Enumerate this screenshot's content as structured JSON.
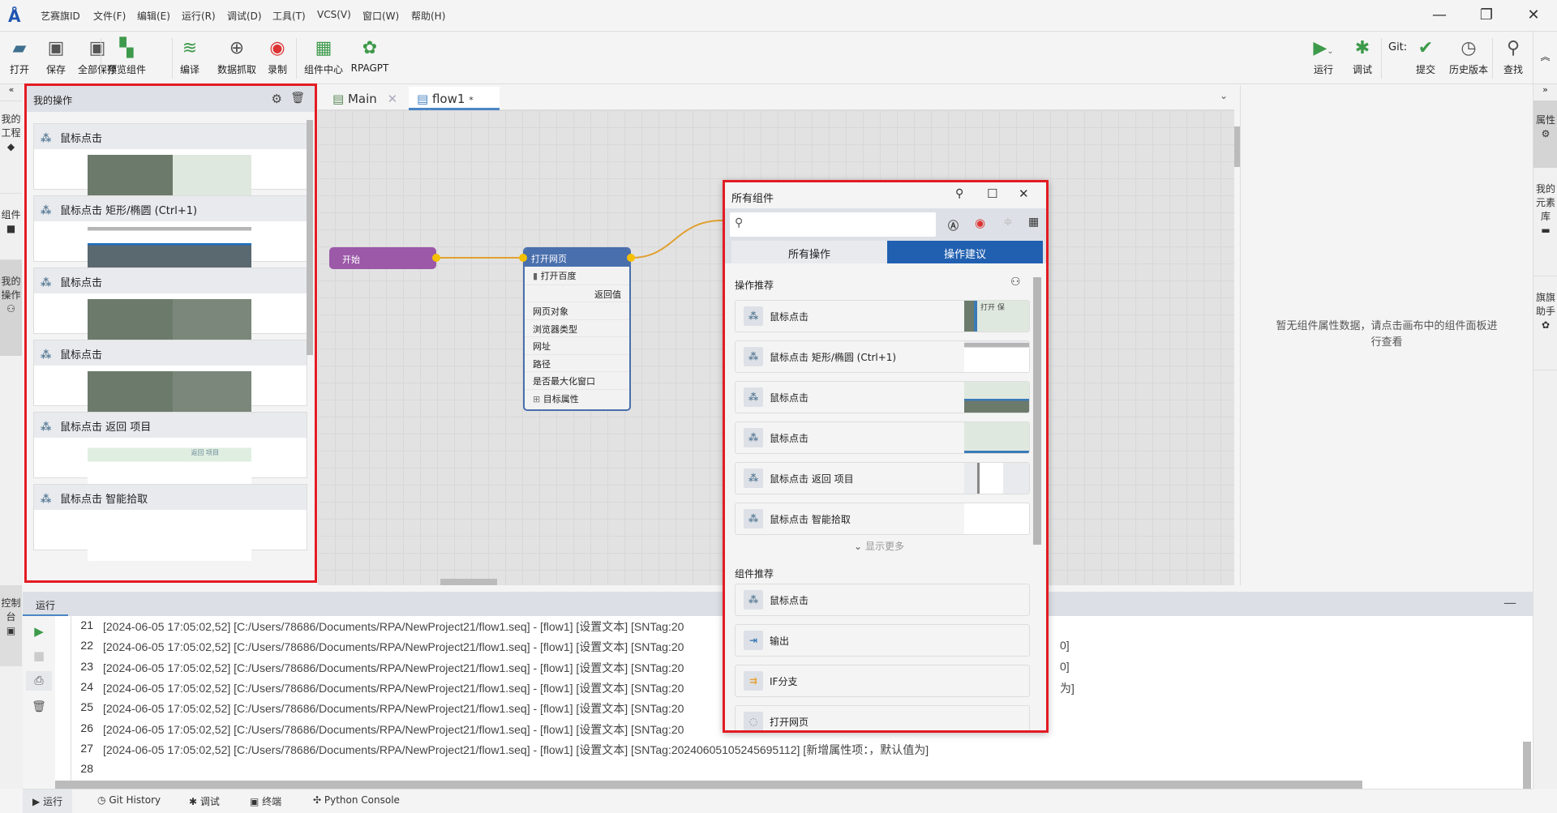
{
  "app": {
    "title": "艺赛旗ID",
    "menu": [
      "文件(F)",
      "编辑(E)",
      "运行(R)",
      "调试(D)",
      "工具(T)",
      "VCS(V)",
      "窗口(W)",
      "帮助(H)"
    ]
  },
  "toolbar": {
    "left": [
      {
        "label": "打开",
        "icon": "folder-open-icon"
      },
      {
        "label": "保存",
        "icon": "save-icon"
      },
      {
        "label": "全部保存",
        "icon": "save-all-icon"
      },
      {
        "label": "预览组件",
        "icon": "preview-components-icon"
      },
      {
        "label": "编译",
        "icon": "compile-icon"
      },
      {
        "label": "数据抓取",
        "icon": "data-scrape-icon"
      },
      {
        "label": "录制",
        "icon": "record-icon"
      },
      {
        "label": "组件中心",
        "icon": "component-center-icon"
      },
      {
        "label": "RPAGPT",
        "icon": "rpagpt-icon"
      }
    ],
    "right": {
      "run": "运行",
      "debug": "调试",
      "git_label": "Git:",
      "commit": "提交",
      "history": "历史版本",
      "search": "查找"
    }
  },
  "left_sidebar": {
    "tabs": [
      "我的工程",
      "组件",
      "我的操作"
    ],
    "console": "控制台"
  },
  "my_operations": {
    "title": "我的操作",
    "items": [
      "鼠标点击",
      "鼠标点击 矩形/椭圆 (Ctrl+1)",
      "鼠标点击",
      "鼠标点击",
      "鼠标点击 返回 项目",
      "鼠标点击 智能拾取"
    ],
    "thumb_text": "返回 项目"
  },
  "editor_tabs": [
    {
      "label": "Main"
    },
    {
      "label": "flow1",
      "modified": "*"
    }
  ],
  "canvas": {
    "start_node": "开始",
    "open_page_node": {
      "title": "打开网页",
      "subtitle": "打开百度",
      "return_label": "返回值",
      "params": [
        "网页对象",
        "浏览器类型",
        "网址",
        "路径",
        "是否最大化窗口"
      ],
      "target_props": "目标属性"
    }
  },
  "properties": {
    "empty_text": "暂无组件属性数据，请点击画布中的组件面板进行查看"
  },
  "right_sidebar": {
    "tabs": [
      "属性",
      "我的元素库",
      "旗旗助手"
    ]
  },
  "dialog": {
    "title": "所有组件",
    "search_placeholder": "",
    "tabs": [
      "所有操作",
      "操作建议"
    ],
    "active_tab": 1,
    "section_ops": "操作推荐",
    "ops": [
      "鼠标点击",
      "鼠标点击 矩形/椭圆 (Ctrl+1)",
      "鼠标点击",
      "鼠标点击",
      "鼠标点击 返回 项目",
      "鼠标点击 智能拾取"
    ],
    "thumb_ops_text": "打开 保",
    "show_more": "显示更多",
    "section_components": "组件推荐",
    "components": [
      "鼠标点击",
      "输出",
      "IF分支",
      "打开网页"
    ]
  },
  "run_panel": {
    "title": "运行",
    "lines": [
      {
        "n": "21",
        "text": "[2024-06-05 17:05:02,52] [C:/Users/78686/Documents/RPA/NewProject21/flow1.seq] - [flow1] [设置文本]  [SNTag:20",
        "tail": ""
      },
      {
        "n": "22",
        "text": "[2024-06-05 17:05:02,52] [C:/Users/78686/Documents/RPA/NewProject21/flow1.seq] - [flow1] [设置文本]  [SNTag:20",
        "tail": "0]"
      },
      {
        "n": "23",
        "text": "[2024-06-05 17:05:02,52] [C:/Users/78686/Documents/RPA/NewProject21/flow1.seq] - [flow1] [设置文本]  [SNTag:20",
        "tail": "0]"
      },
      {
        "n": "24",
        "text": "[2024-06-05 17:05:02,52] [C:/Users/78686/Documents/RPA/NewProject21/flow1.seq] - [flow1] [设置文本]  [SNTag:20",
        "tail": "为]"
      },
      {
        "n": "25",
        "text": "[2024-06-05 17:05:02,52] [C:/Users/78686/Documents/RPA/NewProject21/flow1.seq] - [flow1] [设置文本]  [SNTag:20",
        "tail": ""
      },
      {
        "n": "26",
        "text": "[2024-06-05 17:05:02,52] [C:/Users/78686/Documents/RPA/NewProject21/flow1.seq] - [flow1] [设置文本]  [SNTag:20",
        "tail": ""
      },
      {
        "n": "27",
        "text": "[2024-06-05 17:05:02,52] [C:/Users/78686/Documents/RPA/NewProject21/flow1.seq] - [flow1] [设置文本]  [SNTag:20240605105245695112]  [新增属性项：，默认值为]",
        "tail": ""
      },
      {
        "n": "28",
        "text": "",
        "tail": ""
      }
    ]
  },
  "bottom_tabs": [
    "运行",
    "Git History",
    "调试",
    "终端",
    "Python Console"
  ],
  "colors": {
    "accent": "#2160b0",
    "highlight_border": "#e31b23",
    "start_node": "#9b59a8",
    "open_page_node": "#4a6fad",
    "connector": "#e0a030",
    "run_green": "#3d9a4a"
  }
}
